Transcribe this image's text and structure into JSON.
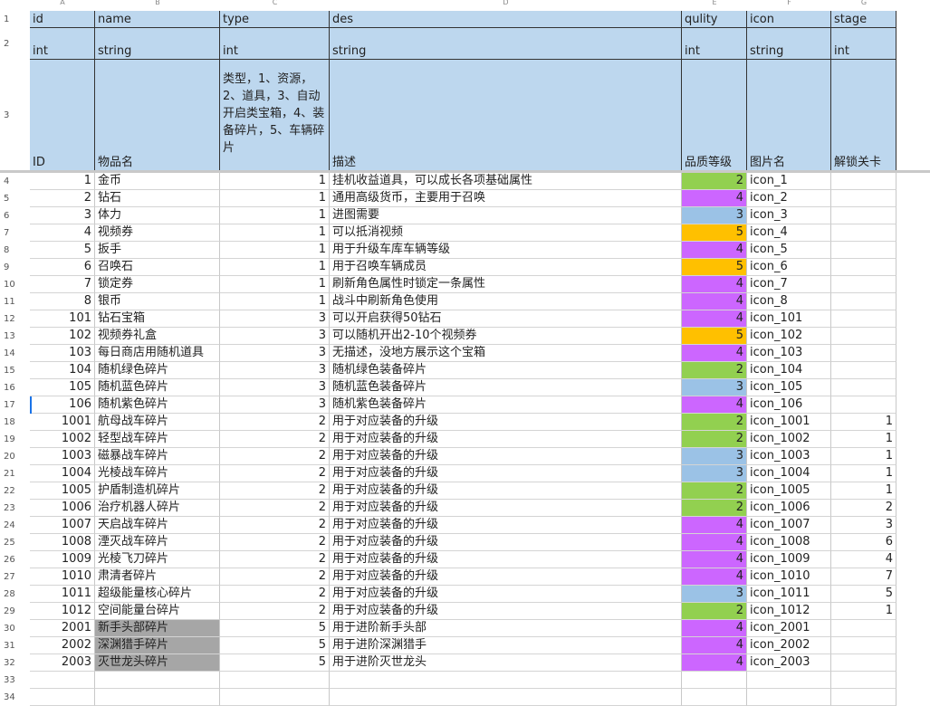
{
  "column_letters": [
    "A",
    "B",
    "C",
    "D",
    "E",
    "F",
    "G"
  ],
  "header_rows": {
    "row1": [
      "id",
      "name",
      "type",
      "des",
      "qulity",
      "icon",
      "stage"
    ],
    "row2": [
      "int",
      "string",
      "int",
      "string",
      "int",
      "string",
      "int"
    ],
    "row3": [
      "ID",
      "物品名",
      "",
      "描述",
      "品质等级",
      "图片名",
      "解锁关卡"
    ],
    "type_note": "类型，1、资源，2、道具，3、自动开启类宝箱，4、装备碎片，5、车辆碎片"
  },
  "row_numbers": [
    "1",
    "2",
    "3",
    "4",
    "5",
    "6",
    "7",
    "8",
    "9",
    "10",
    "11",
    "12",
    "13",
    "14",
    "15",
    "16",
    "17",
    "18",
    "19",
    "20",
    "21",
    "22",
    "23",
    "24",
    "25",
    "26",
    "27",
    "28",
    "29",
    "30",
    "31",
    "32",
    "33",
    "34"
  ],
  "quality_colors": {
    "2": "#92d050",
    "3": "#9bc2e6",
    "4": "#cc66ff",
    "5": "#ffc000"
  },
  "rows": [
    {
      "id": "1",
      "name": "金币",
      "type": "1",
      "des": "挂机收益道具，可以成长各项基础属性",
      "q": "2",
      "icon": "icon_1",
      "stage": ""
    },
    {
      "id": "2",
      "name": "钻石",
      "type": "1",
      "des": "通用高级货币，主要用于召唤",
      "q": "4",
      "icon": "icon_2",
      "stage": ""
    },
    {
      "id": "3",
      "name": "体力",
      "type": "1",
      "des": "进图需要",
      "q": "3",
      "icon": "icon_3",
      "stage": ""
    },
    {
      "id": "4",
      "name": "视频券",
      "type": "1",
      "des": "可以抵消视频",
      "q": "5",
      "icon": "icon_4",
      "stage": ""
    },
    {
      "id": "5",
      "name": "扳手",
      "type": "1",
      "des": "用于升级车库车辆等级",
      "q": "4",
      "icon": "icon_5",
      "stage": ""
    },
    {
      "id": "6",
      "name": "召唤石",
      "type": "1",
      "des": "用于召唤车辆成员",
      "q": "5",
      "icon": "icon_6",
      "stage": ""
    },
    {
      "id": "7",
      "name": "锁定券",
      "type": "1",
      "des": "刷新角色属性时锁定一条属性",
      "q": "4",
      "icon": "icon_7",
      "stage": ""
    },
    {
      "id": "8",
      "name": "银币",
      "type": "1",
      "des": "战斗中刷新角色使用",
      "q": "4",
      "icon": "icon_8",
      "stage": ""
    },
    {
      "id": "101",
      "name": "钻石宝箱",
      "type": "3",
      "des": "可以开启获得50钻石",
      "q": "4",
      "icon": "icon_101",
      "stage": ""
    },
    {
      "id": "102",
      "name": "视频券礼盒",
      "type": "3",
      "des": "可以随机开出2-10个视频券",
      "q": "5",
      "icon": "icon_102",
      "stage": ""
    },
    {
      "id": "103",
      "name": "每日商店用随机道具",
      "type": "3",
      "des": "无描述，没地方展示这个宝箱",
      "q": "4",
      "icon": "icon_103",
      "stage": ""
    },
    {
      "id": "104",
      "name": "随机绿色碎片",
      "type": "3",
      "des": "随机绿色装备碎片",
      "q": "2",
      "icon": "icon_104",
      "stage": ""
    },
    {
      "id": "105",
      "name": "随机蓝色碎片",
      "type": "3",
      "des": "随机蓝色装备碎片",
      "q": "3",
      "icon": "icon_105",
      "stage": ""
    },
    {
      "id": "106",
      "name": "随机紫色碎片",
      "type": "3",
      "des": "随机紫色装备碎片",
      "q": "4",
      "icon": "icon_106",
      "stage": ""
    },
    {
      "id": "1001",
      "name": "航母战车碎片",
      "type": "2",
      "des": "用于对应装备的升级",
      "q": "2",
      "icon": "icon_1001",
      "stage": "1"
    },
    {
      "id": "1002",
      "name": "轻型战车碎片",
      "type": "2",
      "des": "用于对应装备的升级",
      "q": "2",
      "icon": "icon_1002",
      "stage": "1"
    },
    {
      "id": "1003",
      "name": "磁暴战车碎片",
      "type": "2",
      "des": "用于对应装备的升级",
      "q": "3",
      "icon": "icon_1003",
      "stage": "1"
    },
    {
      "id": "1004",
      "name": "光棱战车碎片",
      "type": "2",
      "des": "用于对应装备的升级",
      "q": "3",
      "icon": "icon_1004",
      "stage": "1"
    },
    {
      "id": "1005",
      "name": "护盾制造机碎片",
      "type": "2",
      "des": "用于对应装备的升级",
      "q": "2",
      "icon": "icon_1005",
      "stage": "1"
    },
    {
      "id": "1006",
      "name": "治疗机器人碎片",
      "type": "2",
      "des": "用于对应装备的升级",
      "q": "2",
      "icon": "icon_1006",
      "stage": "2"
    },
    {
      "id": "1007",
      "name": "天启战车碎片",
      "type": "2",
      "des": "用于对应装备的升级",
      "q": "4",
      "icon": "icon_1007",
      "stage": "3"
    },
    {
      "id": "1008",
      "name": "湮灭战车碎片",
      "type": "2",
      "des": "用于对应装备的升级",
      "q": "4",
      "icon": "icon_1008",
      "stage": "6"
    },
    {
      "id": "1009",
      "name": "光棱飞刀碎片",
      "type": "2",
      "des": "用于对应装备的升级",
      "q": "4",
      "icon": "icon_1009",
      "stage": "4"
    },
    {
      "id": "1010",
      "name": "肃清者碎片",
      "type": "2",
      "des": "用于对应装备的升级",
      "q": "4",
      "icon": "icon_1010",
      "stage": "7"
    },
    {
      "id": "1011",
      "name": "超级能量核心碎片",
      "type": "2",
      "des": "用于对应装备的升级",
      "q": "3",
      "icon": "icon_1011",
      "stage": "5"
    },
    {
      "id": "1012",
      "name": "空间能量台碎片",
      "type": "2",
      "des": "用于对应装备的升级",
      "q": "2",
      "icon": "icon_1012",
      "stage": "1"
    },
    {
      "id": "2001",
      "name": "新手头部碎片",
      "type": "5",
      "des": "用于进阶新手头部",
      "q": "4",
      "icon": "icon_2001",
      "stage": "",
      "gray": true
    },
    {
      "id": "2002",
      "name": "深渊猎手碎片",
      "type": "5",
      "des": "用于进阶深渊猎手",
      "q": "4",
      "icon": "icon_2002",
      "stage": "",
      "gray": true
    },
    {
      "id": "2003",
      "name": "灭世龙头碎片",
      "type": "5",
      "des": "用于进阶灭世龙头",
      "q": "4",
      "icon": "icon_2003",
      "stage": "",
      "gray": true
    }
  ]
}
